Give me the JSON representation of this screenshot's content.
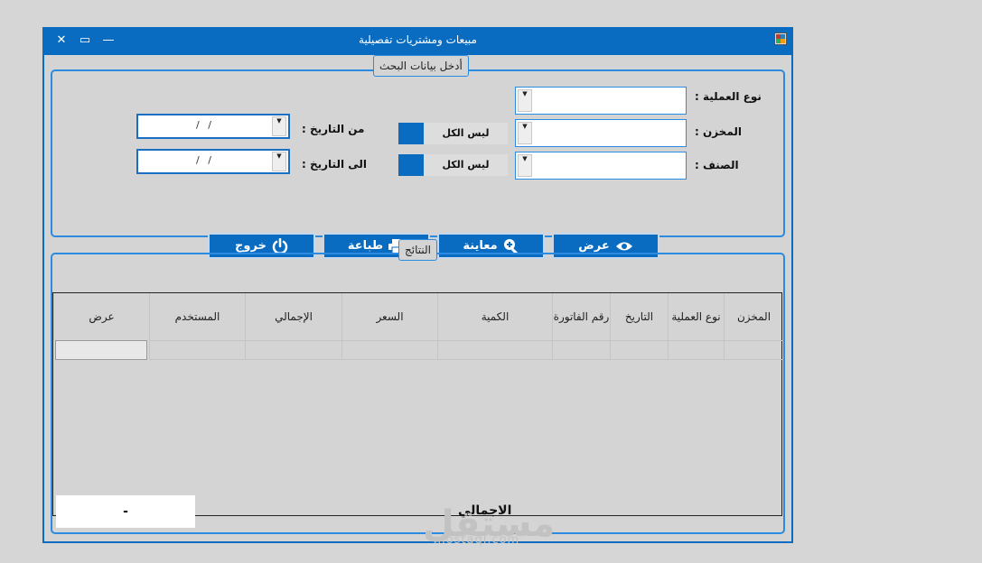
{
  "window": {
    "title": "مبيعات ومشتريات تفصيلية",
    "close": "✕",
    "maximize": "▭",
    "minimize": "—"
  },
  "search_group": {
    "legend": "أدخل بيانات البحث",
    "operation_type_label": "نوع العملية :",
    "warehouse_label": "المخزن :",
    "item_label": "الصنف :",
    "from_date_label": "من التاريخ :",
    "to_date_label": "الى التاريخ :",
    "from_date_value": "/   /",
    "to_date_value": "/   /",
    "warehouse_all": "ليس الكل",
    "item_all": "ليس الكل"
  },
  "actions": {
    "view": "عرض",
    "preview": "معاينة",
    "print": "طباعة",
    "exit": "خروج"
  },
  "results": {
    "legend": "النتائج",
    "columns": [
      "المخزن",
      "نوع العملية",
      "التاريخ",
      "رقم الفاتورة",
      "الكمية",
      "السعر",
      "الإجمالي",
      "المستخدم",
      "عرض"
    ],
    "total_label": "الاجمالي",
    "total_value": "-"
  },
  "watermark": {
    "logo": "مستقل",
    "domain": "mostaql.com"
  },
  "colors": {
    "accent": "#0a6cc0",
    "border": "#2b8be0",
    "background": "#d4d4d4"
  }
}
